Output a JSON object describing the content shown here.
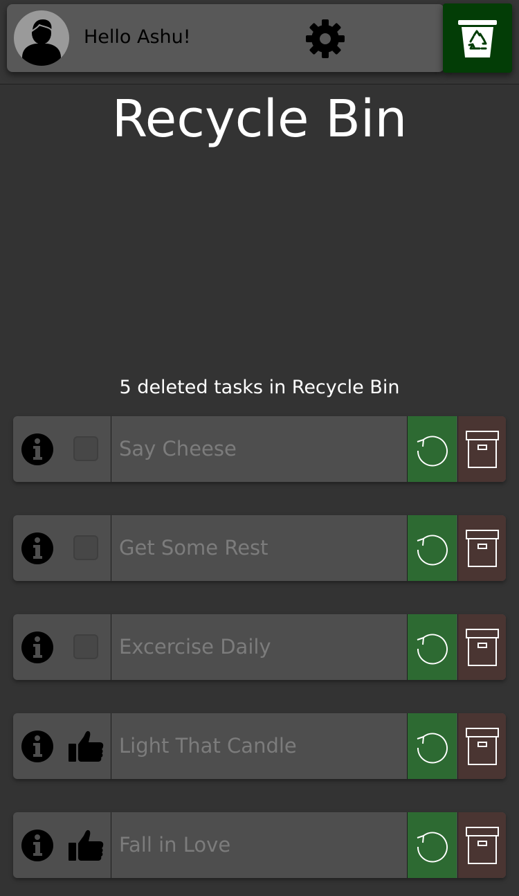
{
  "header": {
    "greeting": "Hello Ashu!",
    "avatar_icon": "user-avatar-icon",
    "settings_icon": "gear-icon",
    "bin_icon": "recycle-bin-icon",
    "bin_button_color": "#033d06"
  },
  "page": {
    "title": "Recycle Bin",
    "deleted_count_text": "5 deleted tasks in Recycle Bin"
  },
  "tasks": [
    {
      "name": "Say Cheese",
      "status_icon": "checkbox-icon",
      "completed": false
    },
    {
      "name": "Get Some Rest",
      "status_icon": "checkbox-icon",
      "completed": false
    },
    {
      "name": "Excercise Daily",
      "status_icon": "checkbox-icon",
      "completed": false
    },
    {
      "name": "Light That Candle",
      "status_icon": "thumbs-up-icon",
      "completed": true
    },
    {
      "name": "Fall in Love",
      "status_icon": "thumbs-up-icon",
      "completed": true
    }
  ],
  "task_actions": {
    "info_icon": "info-icon",
    "restore_icon": "restore-icon",
    "archive_icon": "archive-icon",
    "restore_color": "#2d6a32",
    "archive_color": "#4a3532"
  }
}
